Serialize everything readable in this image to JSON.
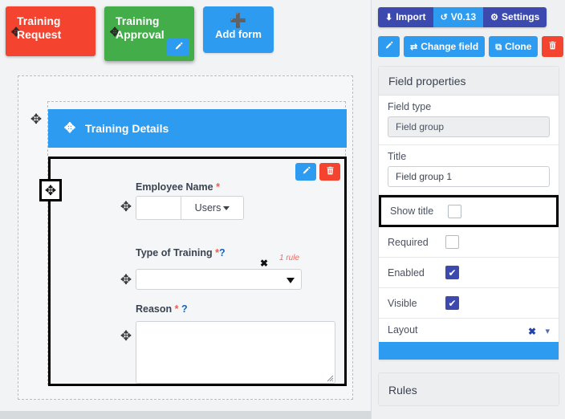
{
  "form_tabs": [
    {
      "label_line1": "Training",
      "label_line2": "Request",
      "color": "#f4432e",
      "move_icon": "move-arrows-icon"
    },
    {
      "label_line1": "Training",
      "label_line2": "Approval",
      "color": "#43ad4a",
      "move_icon": "move-arrows-icon",
      "edit_icon": "pencil-icon"
    }
  ],
  "add_form_button": {
    "label": "Add form",
    "icon": "plus-icon"
  },
  "canvas": {
    "group_header_title": "Training Details",
    "group_header_color": "#2d9cf0",
    "group_actions": {
      "edit_icon": "pencil-icon",
      "delete_icon": "trash-icon"
    },
    "fields": [
      {
        "label": "Employee Name",
        "required_marker": "*",
        "type": "user-picker",
        "value": "",
        "dropdown_label": "Users"
      },
      {
        "label": "Type of Training",
        "required_marker": "*",
        "help_marker": "?",
        "type": "select",
        "value": "",
        "rule_text": "1 rule",
        "rule_clear_icon": "close-x-icon"
      },
      {
        "label": "Reason",
        "required_marker": "*",
        "help_marker": "?",
        "type": "textarea",
        "value": ""
      }
    ]
  },
  "toolbar": {
    "import_label": "Import",
    "import_icon": "download-icon",
    "version_label": "V0.13",
    "version_icon": "history-icon",
    "settings_label": "Settings",
    "settings_icon": "gear-icon",
    "edit_icon": "pencil-icon",
    "change_field_label": "Change field",
    "change_field_icon": "exchange-icon",
    "clone_label": "Clone",
    "clone_icon": "copy-icon",
    "delete_icon": "trash-icon",
    "accent_primary": "#3c4ab0",
    "accent_secondary": "#2d9cf0",
    "accent_danger": "#f4432e"
  },
  "field_properties": {
    "panel_title": "Field properties",
    "field_type_label": "Field type",
    "field_type_value": "Field group",
    "title_label": "Title",
    "title_value": "Field group 1",
    "show_title_label": "Show title",
    "show_title_checked": false,
    "required_label": "Required",
    "required_checked": false,
    "enabled_label": "Enabled",
    "enabled_checked": true,
    "visible_label": "Visible",
    "visible_checked": true,
    "layout_label": "Layout",
    "layout_clear_icon": "close-x-icon",
    "layout_caret_icon": "chevron-down-icon",
    "layout_bar_color": "#2d9cf0",
    "checkbox_checked_glyph": "✔"
  },
  "rules_panel": {
    "title": "Rules"
  }
}
